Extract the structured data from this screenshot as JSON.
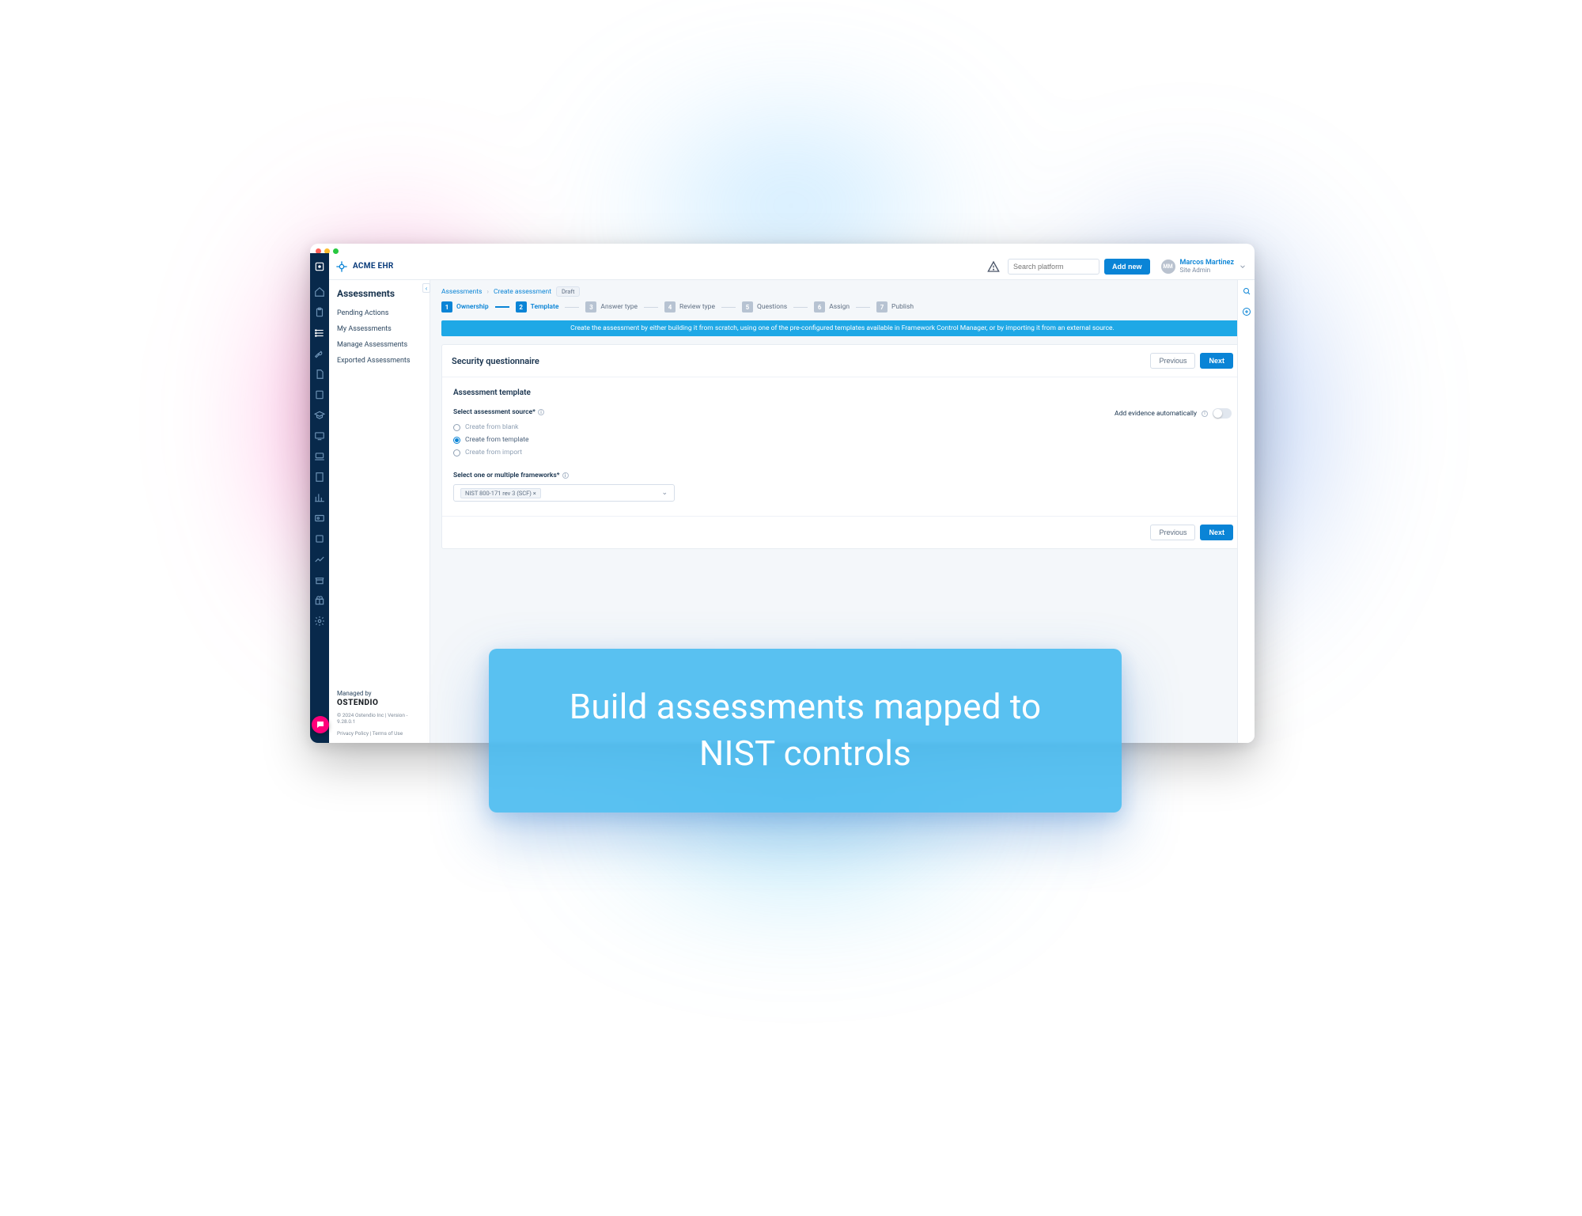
{
  "brand": {
    "name": "ACME EHR"
  },
  "topbar": {
    "search_placeholder": "Search platform",
    "add_new_label": "Add new",
    "user_name": "Marcos Martinez",
    "user_role": "Site Admin",
    "user_initials": "MM"
  },
  "sidebar": {
    "title": "Assessments",
    "items": [
      {
        "label": "Pending Actions"
      },
      {
        "label": "My Assessments"
      },
      {
        "label": "Manage Assessments"
      },
      {
        "label": "Exported Assessments"
      }
    ],
    "managed_by_label": "Managed by",
    "managed_by_brand": "OSTENDIO",
    "legal_line1": "© 2024 Ostendio Inc | Version - 9.28.0.1",
    "legal_line2": "Privacy Policy | Terms of Use"
  },
  "breadcrumbs": {
    "root": "Assessments",
    "current": "Create assessment",
    "status_pill": "Draft"
  },
  "stepper": [
    {
      "num": "1",
      "label": "Ownership",
      "state": "done"
    },
    {
      "num": "2",
      "label": "Template",
      "state": "active"
    },
    {
      "num": "3",
      "label": "Answer type",
      "state": ""
    },
    {
      "num": "4",
      "label": "Review type",
      "state": ""
    },
    {
      "num": "5",
      "label": "Questions",
      "state": ""
    },
    {
      "num": "6",
      "label": "Assign",
      "state": ""
    },
    {
      "num": "7",
      "label": "Publish",
      "state": ""
    }
  ],
  "banner": "Create the assessment by either building it from scratch, using one of the pre-configured templates available in Framework Control Manager, or by importing it from an external source.",
  "card": {
    "title": "Security questionnaire",
    "prev_label": "Previous",
    "next_label": "Next"
  },
  "form": {
    "section_title": "Assessment template",
    "source_label": "Select assessment source*",
    "options": [
      {
        "label": "Create from blank",
        "checked": false
      },
      {
        "label": "Create from template",
        "checked": true
      },
      {
        "label": "Create from import",
        "checked": false
      }
    ],
    "evidence_toggle_label": "Add evidence automatically",
    "frameworks_label": "Select one or multiple frameworks*",
    "frameworks_selected": "NIST 800-171 rev 3 (SCF) ×"
  },
  "overlay_caption": "Build assessments mapped to NIST controls"
}
